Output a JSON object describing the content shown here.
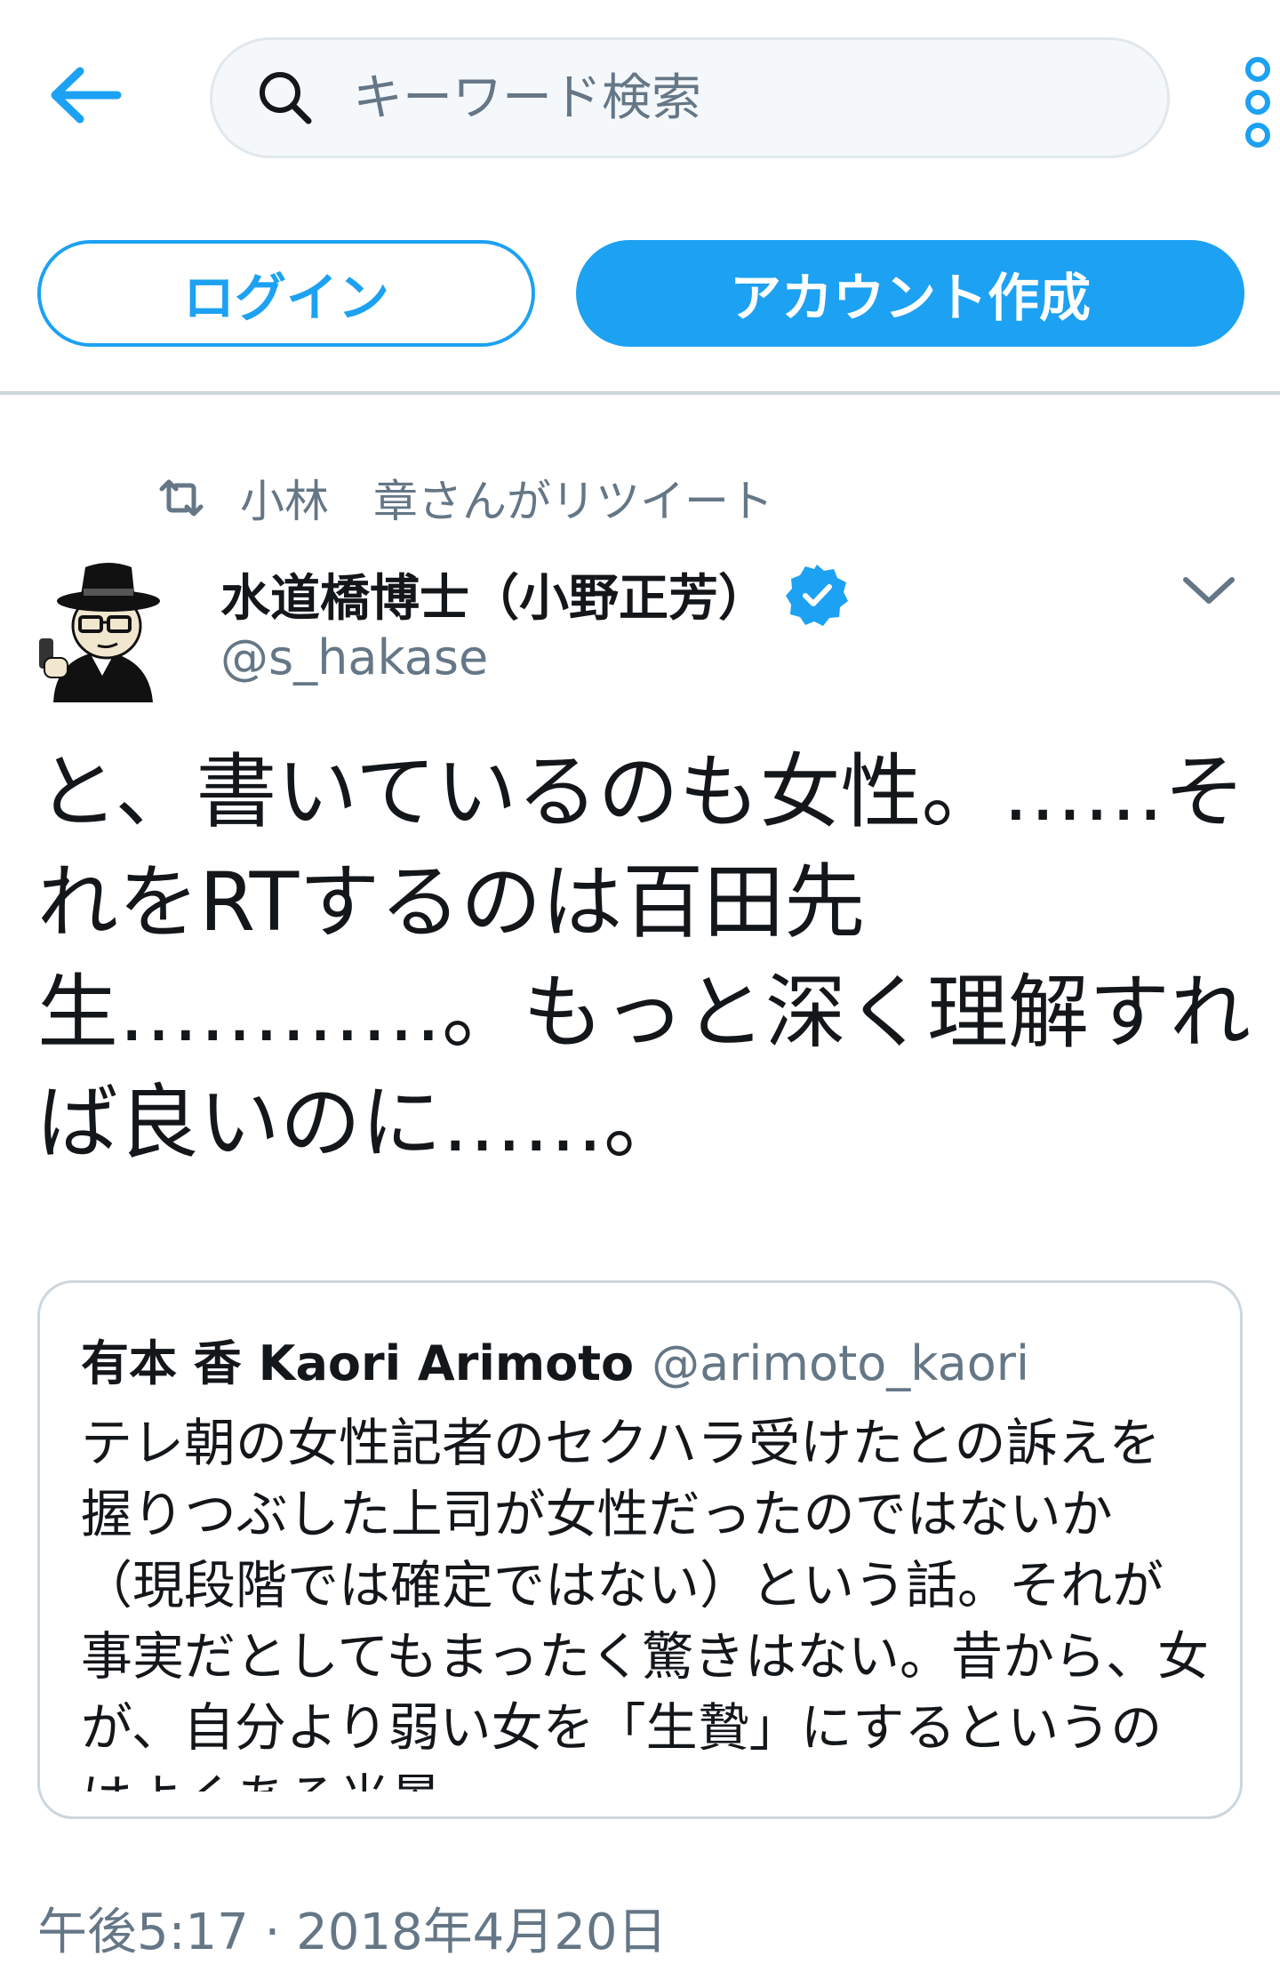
{
  "header": {
    "search_placeholder": "キーワード検索",
    "login_label": "ログイン",
    "signup_label": "アカウント作成"
  },
  "colors": {
    "accent": "#1da1f2",
    "secondary_text": "#657786",
    "border": "#ccd6dd"
  },
  "icons": {
    "back": "back-arrow-icon",
    "search": "search-icon",
    "more": "more-vertical-icon",
    "retweet": "retweet-icon",
    "verified": "verified-badge-icon",
    "caret": "chevron-down-icon"
  },
  "tweet": {
    "retweeted_by": "小林　章さんがリツイート",
    "author_name": "水道橋博士（小野正芳）",
    "author_handle": "@s_hakase",
    "text": "と、書いているのも女性。……そ\nれをRTするのは百田先\n生…………。もっと深く理解すれ\nば良いのに……。",
    "timestamp": "午後5:17 · 2018年4月20日"
  },
  "quoted_tweet": {
    "author_name": "有本 香 Kaori Arimoto",
    "author_handle": "@arimoto_kaori",
    "text": "テレ朝の女性記者のセクハラ受けたとの訴えを握りつぶした上司が女性だったのではないか（現段階では確定ではない）という話。それが事実だとしてもまったく驚きはない。昔から、女が、自分より弱い女を「生贄」にするというのはよくある光景。"
  }
}
